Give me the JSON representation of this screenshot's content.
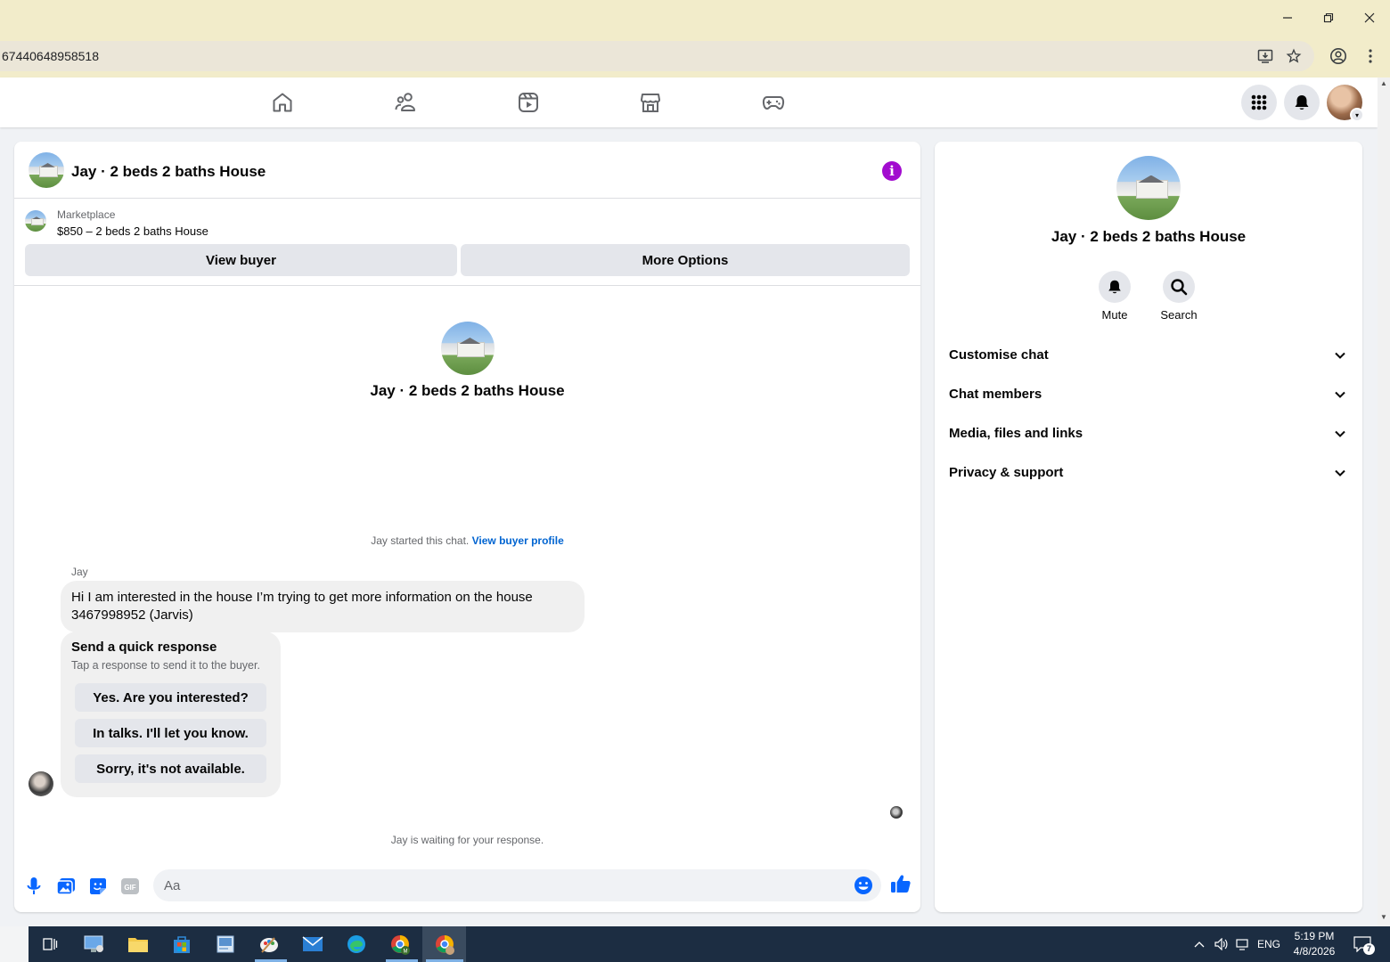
{
  "browser": {
    "url": "67440648958518",
    "window_controls": [
      "minimize-icon",
      "restore-icon",
      "close-icon"
    ]
  },
  "nav": {
    "icons": [
      "home-icon",
      "friends-icon",
      "video-icon",
      "marketplace-icon",
      "gaming-icon"
    ],
    "right": [
      "menu-grid-icon",
      "notifications-icon",
      "profile-avatar"
    ]
  },
  "chat": {
    "title": "Jay · 2 beds 2 baths House",
    "marketplace_label": "Marketplace",
    "listing": "$850 – 2 beds 2 baths House",
    "view_buyer": "View buyer",
    "more_options": "More Options",
    "intro_name": "Jay · 2 beds 2 baths House",
    "started_text": "Jay started this chat.",
    "view_buyer_profile": "View buyer profile",
    "sender": "Jay",
    "message": "Hi I am interested in the house I’m trying to get more information on the house 3467998952 (Jarvis)",
    "quick_response": {
      "title": "Send a quick response",
      "subtitle": "Tap a response to send it to the buyer.",
      "options": [
        "Yes. Are you interested?",
        "In talks. I'll let you know.",
        "Sorry, it's not available."
      ]
    },
    "waiting": "Jay is waiting for your response.",
    "composer_placeholder": "Aa",
    "accent_color": "#0866ff"
  },
  "info": {
    "name": "Jay · 2 beds 2 baths House",
    "mute": "Mute",
    "search": "Search",
    "sections": [
      "Customise chat",
      "Chat members",
      "Media, files and links",
      "Privacy & support"
    ]
  },
  "taskbar": {
    "time": "5:19 PM",
    "date": "4/8/2026",
    "lang": "ENG",
    "notif_count": "7"
  }
}
